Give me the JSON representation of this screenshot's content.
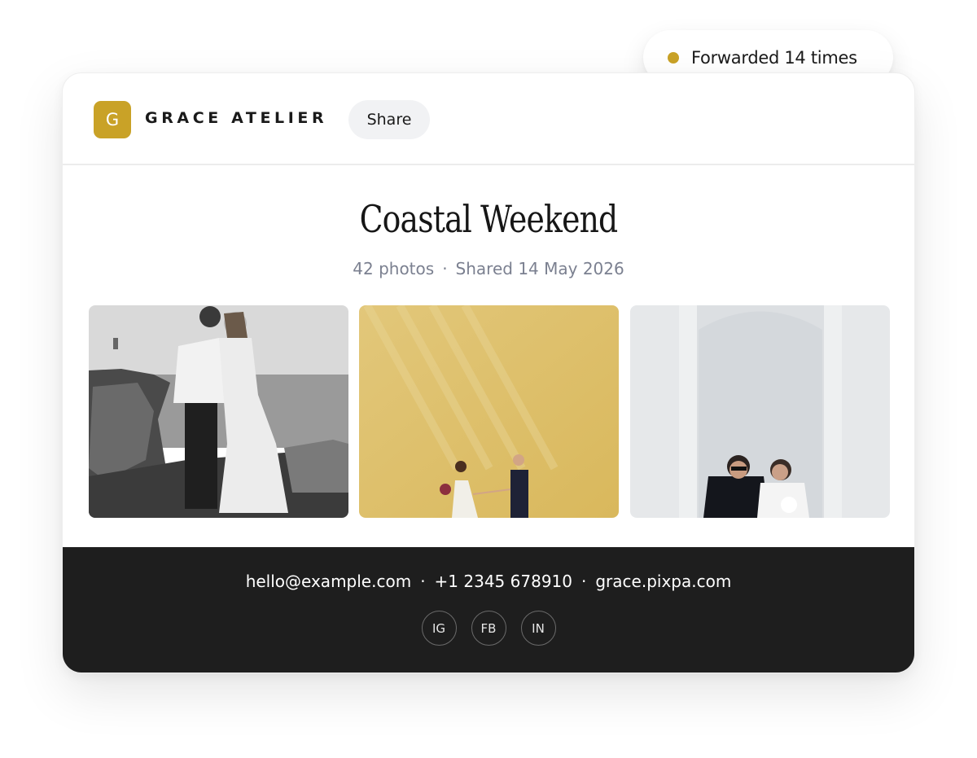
{
  "colors": {
    "accent": "#c9a227",
    "footer_bg": "#1e1e1e",
    "meta_text": "#7b8090"
  },
  "badge": {
    "text": "Forwarded 14 times"
  },
  "header": {
    "logo_letter": "G",
    "brand": "GRACE ATELIER",
    "share_label": "Share"
  },
  "album": {
    "title": "Coastal Weekend",
    "photo_count": "42 photos",
    "separator": "·",
    "shared": "Shared 14 May 2026"
  },
  "footer": {
    "email": "hello@example.com",
    "phone": "+1 2345 678910",
    "website": "grace.pixpa.com",
    "separator": "·",
    "socials": [
      "IG",
      "FB",
      "IN"
    ]
  }
}
